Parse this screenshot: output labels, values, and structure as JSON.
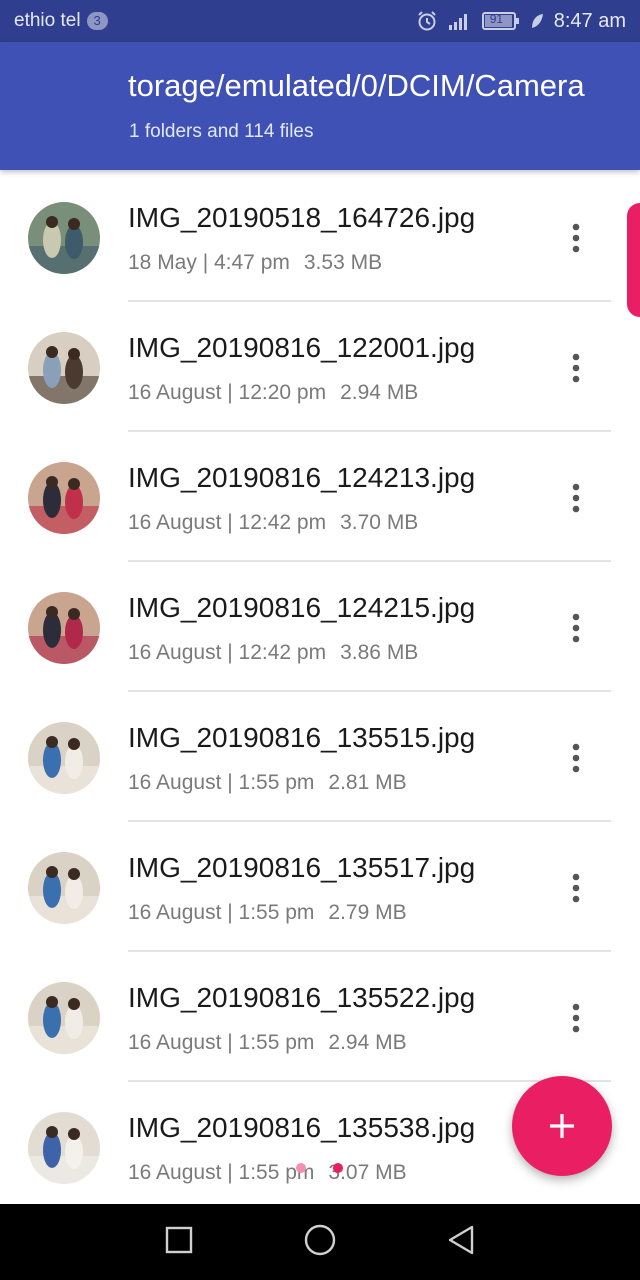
{
  "status_bar": {
    "carrier": "ethio tel",
    "notification_count": "3",
    "battery": "91",
    "time": "8:47 am",
    "icons": [
      "alarm-icon",
      "signal-icon",
      "battery-icon",
      "leaf-icon"
    ]
  },
  "app_bar": {
    "path": "torage/emulated/0/DCIM/Camera",
    "subtitle": "1 folders and 114 files"
  },
  "files": [
    {
      "name": "IMG_20190518_164726.jpg",
      "date": "18 May | 4:47 pm",
      "size": "3.53 MB"
    },
    {
      "name": "IMG_20190816_122001.jpg",
      "date": "16 August | 12:20 pm",
      "size": "2.94 MB"
    },
    {
      "name": "IMG_20190816_124213.jpg",
      "date": "16 August | 12:42 pm",
      "size": "3.70 MB"
    },
    {
      "name": "IMG_20190816_124215.jpg",
      "date": "16 August | 12:42 pm",
      "size": "3.86 MB"
    },
    {
      "name": "IMG_20190816_135515.jpg",
      "date": "16 August | 1:55 pm",
      "size": "2.81 MB"
    },
    {
      "name": "IMG_20190816_135517.jpg",
      "date": "16 August | 1:55 pm",
      "size": "2.79 MB"
    },
    {
      "name": "IMG_20190816_135522.jpg",
      "date": "16 August | 1:55 pm",
      "size": "2.94 MB"
    },
    {
      "name": "IMG_20190816_135538.jpg",
      "date": "16 August | 1:55 pm",
      "size": "3.07 MB"
    }
  ],
  "fab": {
    "label": "+",
    "icon": "plus-icon"
  },
  "nav_bar": {
    "buttons": [
      "recents-icon",
      "home-icon",
      "back-icon"
    ]
  },
  "colors": {
    "status_bar": "#2f3e8f",
    "app_bar": "#3f51b5",
    "accent": "#e91e63"
  }
}
